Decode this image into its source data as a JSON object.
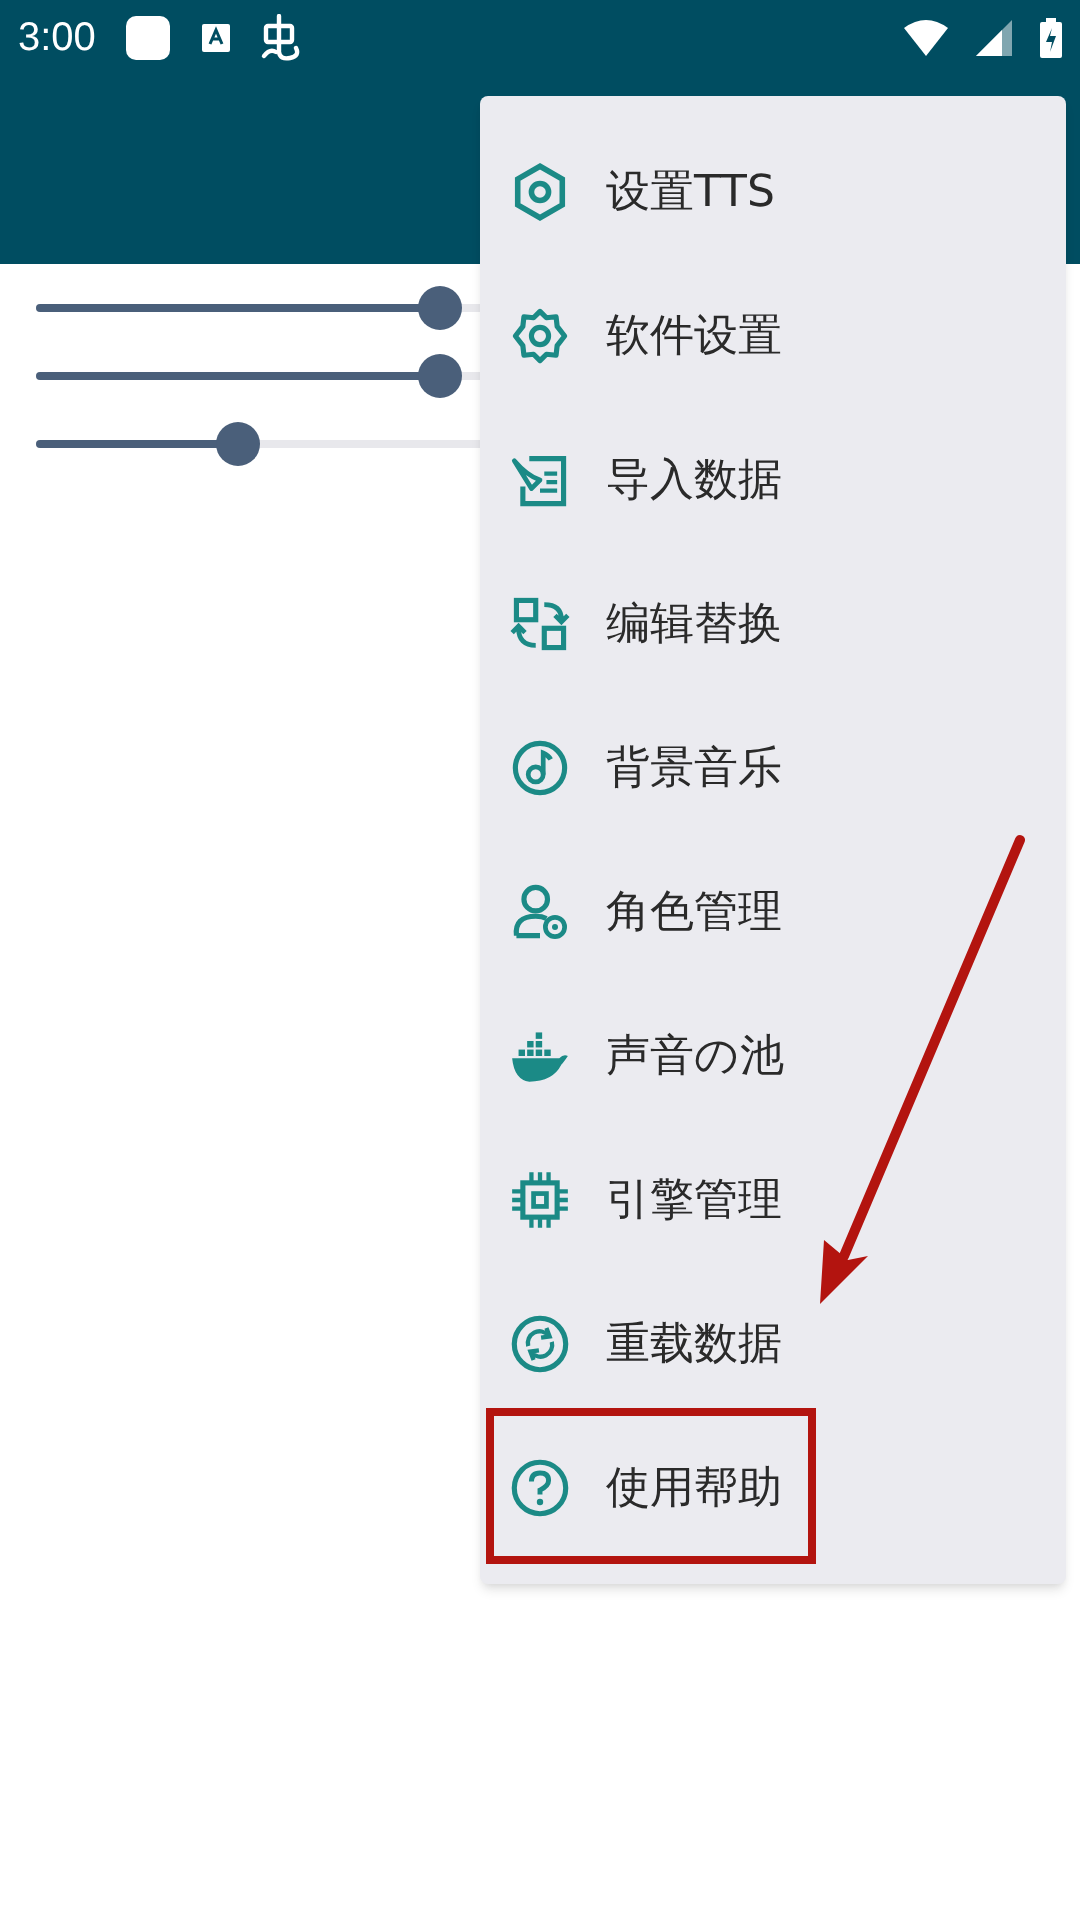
{
  "status_bar": {
    "time": "3:00"
  },
  "sliders": [
    {
      "level": 0.4
    },
    {
      "level": 0.4
    },
    {
      "level": 0.2
    }
  ],
  "menu": {
    "items": [
      {
        "label": "设置TTS"
      },
      {
        "label": "软件设置"
      },
      {
        "label": "导入数据"
      },
      {
        "label": "编辑替换"
      },
      {
        "label": "背景音乐"
      },
      {
        "label": "角色管理"
      },
      {
        "label": "声音の池"
      },
      {
        "label": "引擎管理"
      },
      {
        "label": "重载数据"
      },
      {
        "label": "使用帮助"
      }
    ]
  }
}
